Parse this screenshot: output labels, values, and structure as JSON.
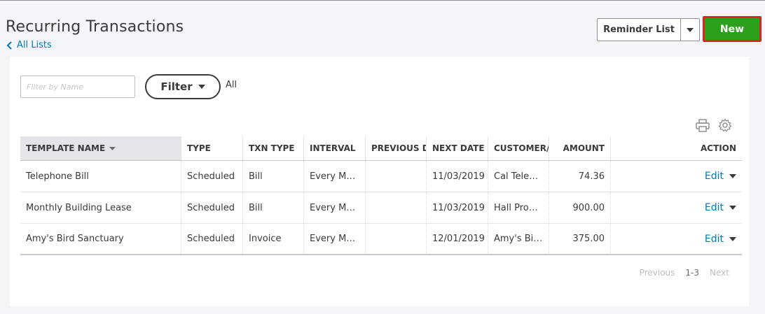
{
  "header": {
    "title": "Recurring Transactions",
    "back_link": "All Lists",
    "reminder_label": "Reminder List",
    "new_label": "New"
  },
  "filters": {
    "search_placeholder": "Filter by Name",
    "filter_label": "Filter",
    "filter_value": "All"
  },
  "table": {
    "columns": [
      "TEMPLATE NAME",
      "TYPE",
      "TXN TYPE",
      "INTERVAL",
      "PREVIOUS DA",
      "NEXT DATE",
      "CUSTOMER/V",
      "AMOUNT",
      "ACTION"
    ],
    "rows": [
      {
        "name": "Telephone Bill",
        "type": "Scheduled",
        "txn": "Bill",
        "interval": "Every Mo…",
        "prev": "",
        "next": "11/03/2019",
        "customer": "Cal Telep…",
        "amount": "74.36",
        "action": "Edit"
      },
      {
        "name": "Monthly Building Lease",
        "type": "Scheduled",
        "txn": "Bill",
        "interval": "Every Mo…",
        "prev": "",
        "next": "11/03/2019",
        "customer": "Hall Prop…",
        "amount": "900.00",
        "action": "Edit"
      },
      {
        "name": "Amy's Bird Sanctuary",
        "type": "Scheduled",
        "txn": "Invoice",
        "interval": "Every Mo…",
        "prev": "",
        "next": "12/01/2019",
        "customer": "Amy's Bir…",
        "amount": "375.00",
        "action": "Edit"
      }
    ]
  },
  "pagination": {
    "previous": "Previous",
    "range": "1-3",
    "next": "Next"
  },
  "colors": {
    "accent_green": "#2ca01c",
    "highlight_red": "#e0231b",
    "link_blue": "#0077c5"
  }
}
